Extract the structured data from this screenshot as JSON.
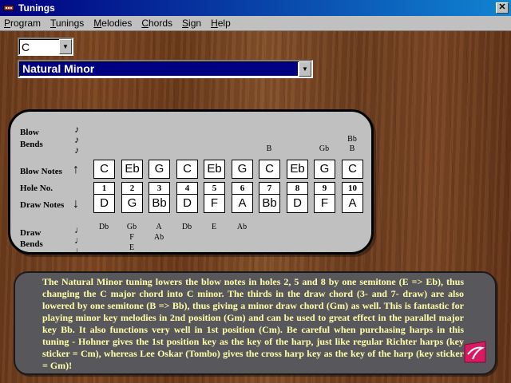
{
  "window": {
    "title": "Tunings",
    "close_glyph": "✕"
  },
  "menu": [
    {
      "pre": "",
      "ul": "P",
      "post": "rogram"
    },
    {
      "pre": "",
      "ul": "T",
      "post": "unings"
    },
    {
      "pre": "",
      "ul": "M",
      "post": "elodies"
    },
    {
      "pre": "",
      "ul": "C",
      "post": "hords"
    },
    {
      "pre": "",
      "ul": "S",
      "post": "ign"
    },
    {
      "pre": "",
      "ul": "H",
      "post": "elp"
    }
  ],
  "key_select": {
    "value": "C"
  },
  "scale_select": {
    "value": "Natural Minor"
  },
  "labels": {
    "blow": "Blow",
    "bends_top": "Bends",
    "blow_notes": "Blow Notes",
    "hole_no": "Hole No.",
    "draw_notes": "Draw Notes",
    "draw": "Draw",
    "bends_bottom": "Bends"
  },
  "blow_bends": [
    [],
    [],
    [],
    [],
    [],
    [],
    [
      "B"
    ],
    [],
    [
      "Gb"
    ],
    [
      "Bb",
      "B"
    ]
  ],
  "blow_notes": [
    "C",
    "Eb",
    "G",
    "C",
    "Eb",
    "G",
    "C",
    "Eb",
    "G",
    "C"
  ],
  "holes": [
    "1",
    "2",
    "3",
    "4",
    "5",
    "6",
    "7",
    "8",
    "9",
    "10"
  ],
  "draw_notes": [
    "D",
    "G",
    "Bb",
    "D",
    "F",
    "A",
    "Bb",
    "D",
    "F",
    "A"
  ],
  "draw_bends": [
    [
      "Db"
    ],
    [
      "Gb",
      "F",
      "E"
    ],
    [
      "A",
      "Ab"
    ],
    [
      "Db"
    ],
    [
      "E"
    ],
    [
      "Ab"
    ],
    [],
    [],
    [],
    []
  ],
  "description": "The Natural Minor tuning lowers the blow notes in holes 2, 5 and 8 by one semitone (E => Eb), thus changing the C major chord into C minor. The thirds in the draw chord (3- and 7- draw) are also lowered by one semitone (B => Bb), thus giving a minor draw chord (Gm) as well. This is fantastic for playing minor key melodies in 2nd position (Gm) and can be used to great effect in the parallel major key Bb. It also functions very well in 1st position (Cm). Be careful when purchasing harps in this tuning  -  Hohner gives the 1st position key as the key of the harp, just like regular Richter harps (key sticker = Cm), whereas Lee Oskar (Tombo) gives the cross harp key as the key of the harp (key sticker = Gm)!",
  "icons": {
    "app": "harmonica-icon",
    "logo": "lee-oskar-logo-icon"
  },
  "colors": {
    "desc_text": "#ffffa8",
    "desc_bg": "#58585c",
    "panel_bg": "#c0c0c0",
    "titlebar": "#000080"
  }
}
